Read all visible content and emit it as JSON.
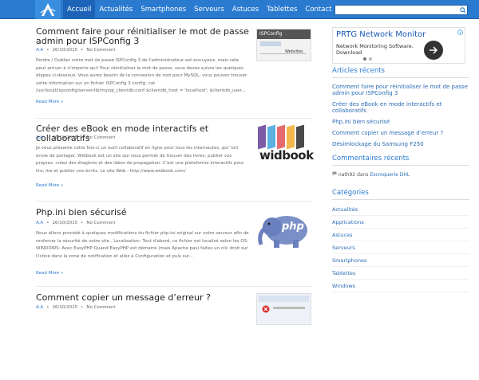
{
  "nav": {
    "items": [
      "Accueil",
      "Actualités",
      "Smartphones",
      "Serveurs",
      "Astuces",
      "Tablettes",
      "Contact"
    ],
    "active_index": 0
  },
  "search": {
    "placeholder": ""
  },
  "posts": [
    {
      "title": "Comment faire pour réinitialiser le mot de passe admin pour ISPConfig 3",
      "author": "A.A",
      "date": "26/10/2015",
      "comments": "No Comment",
      "excerpt": "Perdre / Oublier votre mot de passe ISPConfig 3 de l'administrateur est ennuyeux, mais cela peut arriver à n'importe qui! Pour réinitialiser le mot de passe, vous devez suivre les quelques étapes ci-dessous. Vous aurez besoin de la connexion de root pour MySQL, vous pouvez trouver cette information sur un fichier ISPConfig 3 config. cat /usr/local/ispconfig/server/lib/mysql_clientdb.conf $clientdb_host = 'localhost'; $clientdb_user...",
      "readmore": "Read More »",
      "thumb": {
        "label": "ISPConfig",
        "sub": "Websites"
      }
    },
    {
      "title": "Créer des eBook en mode interactifs et collaboratifs",
      "author": "A.A",
      "date": "26/10/2015",
      "comments": "No Comment",
      "excerpt": "Je vous présente cette fois-ci un outil collaboratif en ligne pour tous les internautes, qui 'ont envie de partager. Widbook est un site qui vous permet de trouver des livres, publier vos propres, créez des étagères et des idées de propagation. C'est une plateforme interactifs pour lire, lire et publier vos écrits. Le site Web : http://www.widbook.com/",
      "readmore": "Read More »",
      "thumb": {
        "label": "widbook"
      }
    },
    {
      "title": "Php.ini bien sécurisé",
      "author": "A.A",
      "date": "26/10/2015",
      "comments": "No Comment",
      "excerpt": "Nous allons procédé à quelques modifications du fichier php.ini original sur votre serveur afin de renforcer la sécurité de votre site . Localisation: Tout d'abord, ce fichier est localisé selon les OS: WINDOWS: Avec EasyPHP Quand EasyPHP est démarré (mais Apache pas) faites un clic droit sur l'icône dans la zone de notification et allez à Configuration et puis sur...",
      "readmore": "Read More »",
      "thumb": {
        "label": "php"
      }
    },
    {
      "title": "Comment copier un message d’erreur ?",
      "author": "A.A",
      "date": "26/10/2015",
      "comments": "No Comment",
      "excerpt": "",
      "readmore": "",
      "thumb": {
        "label": ""
      }
    }
  ],
  "ad": {
    "title": "PRTG Network Monitor",
    "text": "Network Monitoring Software. Download"
  },
  "sidebar": {
    "recent_title": "Articles récents",
    "recent": [
      "Comment faire pour réinitialiser le mot de passe admin pour ISPConfig 3",
      "Créer des eBook en mode interactifs et collaboratifs",
      "Php.ini bien sécurisé",
      "Comment copier un message d’erreur ?",
      "Désimlockage du Samsung F250"
    ],
    "comments_title": "Commentaires récents",
    "comments": [
      {
        "author": "nath92",
        "sep": "dans",
        "post": "Escroquerie DHL"
      }
    ],
    "cat_title": "Catégories",
    "categories": [
      "Actualités",
      "Applications",
      "Astuces",
      "Serveurs",
      "Smartphones",
      "Tablettes",
      "Windows"
    ]
  },
  "colors": {
    "accent": "#2a7bd0",
    "nav_active": "#1d64b8"
  }
}
